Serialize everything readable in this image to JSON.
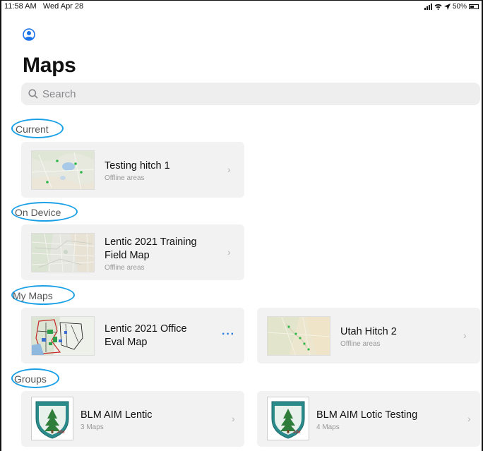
{
  "status": {
    "time": "11:58 AM",
    "date": "Wed Apr 28",
    "battery": "50%"
  },
  "header": {
    "title": "Maps"
  },
  "search": {
    "placeholder": "Search"
  },
  "sections": {
    "current": "Current",
    "on_device": "On Device",
    "my_maps": "My Maps",
    "groups": "Groups"
  },
  "current_maps": [
    {
      "title": "Testing hitch 1",
      "subtitle": "Offline areas"
    }
  ],
  "device_maps": [
    {
      "title_line1": "Lentic 2021 Training",
      "title_line2": "Field Map",
      "subtitle": "Offline areas"
    }
  ],
  "my_maps": [
    {
      "title_line1": "Lentic 2021 Office",
      "title_line2": "Eval Map",
      "more": "···"
    },
    {
      "title": "Utah Hitch 2",
      "subtitle": "Offline areas"
    }
  ],
  "groups": [
    {
      "title": "BLM AIM Lentic",
      "subtitle": "3 Maps",
      "logo_text": "AIM"
    },
    {
      "title": "BLM AIM Lotic Testing",
      "subtitle": "4 Maps",
      "logo_text": "AIM"
    }
  ],
  "colors": {
    "highlight": "#1aa0e6",
    "accent": "#2277dd",
    "card": "#f2f2f3"
  }
}
